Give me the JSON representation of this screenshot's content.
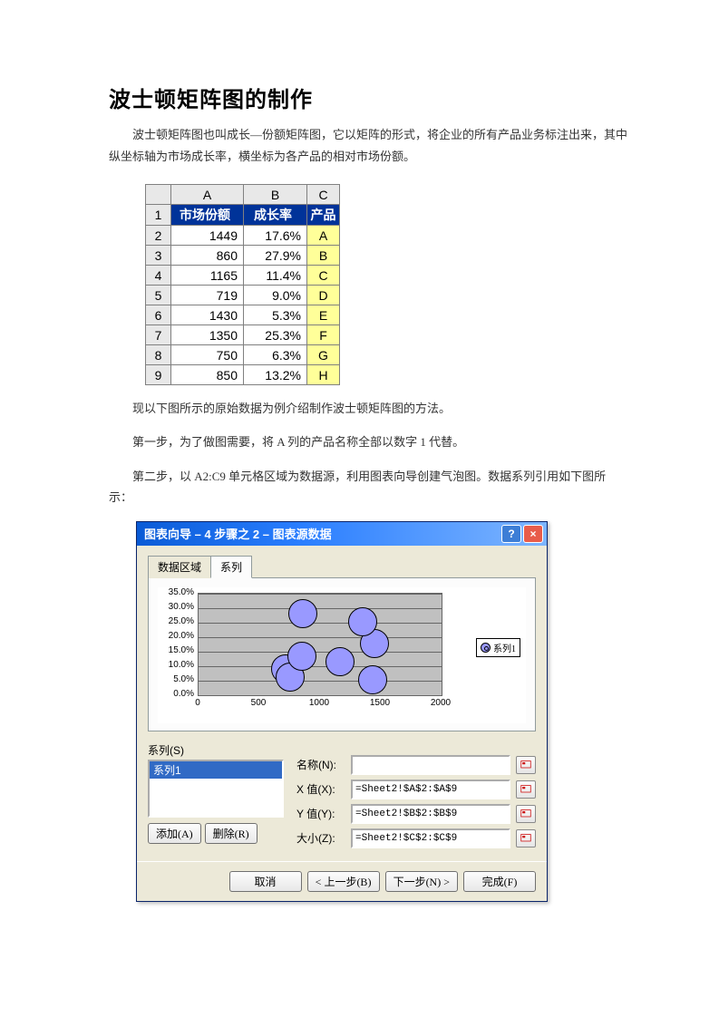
{
  "title": "波士顿矩阵图的制作",
  "intro": "波士顿矩阵图也叫成长—份额矩阵图，它以矩阵的形式，将企业的所有产品业务标注出来，其中纵坐标轴为市场成长率，横坐标为各产品的相对市场份额。",
  "table": {
    "columns": [
      "A",
      "B",
      "C"
    ],
    "headers": [
      "市场份额",
      "成长率",
      "产品"
    ],
    "rows": [
      {
        "n": "1"
      },
      {
        "n": "2",
        "a": "1449",
        "b": "17.6%",
        "c": "A"
      },
      {
        "n": "3",
        "a": "860",
        "b": "27.9%",
        "c": "B"
      },
      {
        "n": "4",
        "a": "1165",
        "b": "11.4%",
        "c": "C"
      },
      {
        "n": "5",
        "a": "719",
        "b": "9.0%",
        "c": "D"
      },
      {
        "n": "6",
        "a": "1430",
        "b": "5.3%",
        "c": "E"
      },
      {
        "n": "7",
        "a": "1350",
        "b": "25.3%",
        "c": "F"
      },
      {
        "n": "8",
        "a": "750",
        "b": "6.3%",
        "c": "G"
      },
      {
        "n": "9",
        "a": "850",
        "b": "13.2%",
        "c": "H"
      }
    ]
  },
  "step_intro": "现以下图所示的原始数据为例介绍制作波士顿矩阵图的方法。",
  "step1": "第一步，为了做图需要，将 A 列的产品名称全部以数字 1 代替。",
  "step2": "第二步，以 A2:C9 单元格区域为数据源，利用图表向导创建气泡图。数据系列引用如下图所示：",
  "dialog": {
    "title": "图表向导 – 4 步骤之 2 – 图表源数据",
    "help_btn": "?",
    "close_btn": "×",
    "tabs": {
      "data": "数据区域",
      "series": "系列"
    },
    "chart": {
      "yticks": [
        "35.0%",
        "30.0%",
        "25.0%",
        "20.0%",
        "15.0%",
        "10.0%",
        "5.0%",
        "0.0%"
      ],
      "xticks": [
        "0",
        "500",
        "1000",
        "1500",
        "2000"
      ],
      "legend": "系列1"
    },
    "series_label": "系列(S)",
    "series_item": "系列1",
    "add_btn": "添加(A)",
    "del_btn": "删除(R)",
    "fields": {
      "name": {
        "label": "名称(N):",
        "value": ""
      },
      "x": {
        "label": "X 值(X):",
        "value": "=Sheet2!$A$2:$A$9"
      },
      "y": {
        "label": "Y 值(Y):",
        "value": "=Sheet2!$B$2:$B$9"
      },
      "size": {
        "label": "大小(Z):",
        "value": "=Sheet2!$C$2:$C$9"
      }
    },
    "footer": {
      "cancel": "取消",
      "back": "< 上一步(B)",
      "next": "下一步(N) >",
      "finish": "完成(F)"
    }
  },
  "chart_data": {
    "type": "scatter",
    "title": "",
    "xlabel": "",
    "ylabel": "",
    "xlim": [
      0,
      2000
    ],
    "ylim": [
      0,
      0.35
    ],
    "xticks": [
      0,
      500,
      1000,
      1500,
      2000
    ],
    "yticks": [
      0,
      0.05,
      0.1,
      0.15,
      0.2,
      0.25,
      0.3,
      0.35
    ],
    "series": [
      {
        "name": "系列1",
        "points": [
          {
            "x": 1449,
            "y": 0.176,
            "size": 1
          },
          {
            "x": 860,
            "y": 0.279,
            "size": 1
          },
          {
            "x": 1165,
            "y": 0.114,
            "size": 1
          },
          {
            "x": 719,
            "y": 0.09,
            "size": 1
          },
          {
            "x": 1430,
            "y": 0.053,
            "size": 1
          },
          {
            "x": 1350,
            "y": 0.253,
            "size": 1
          },
          {
            "x": 750,
            "y": 0.063,
            "size": 1
          },
          {
            "x": 850,
            "y": 0.132,
            "size": 1
          }
        ]
      }
    ]
  }
}
